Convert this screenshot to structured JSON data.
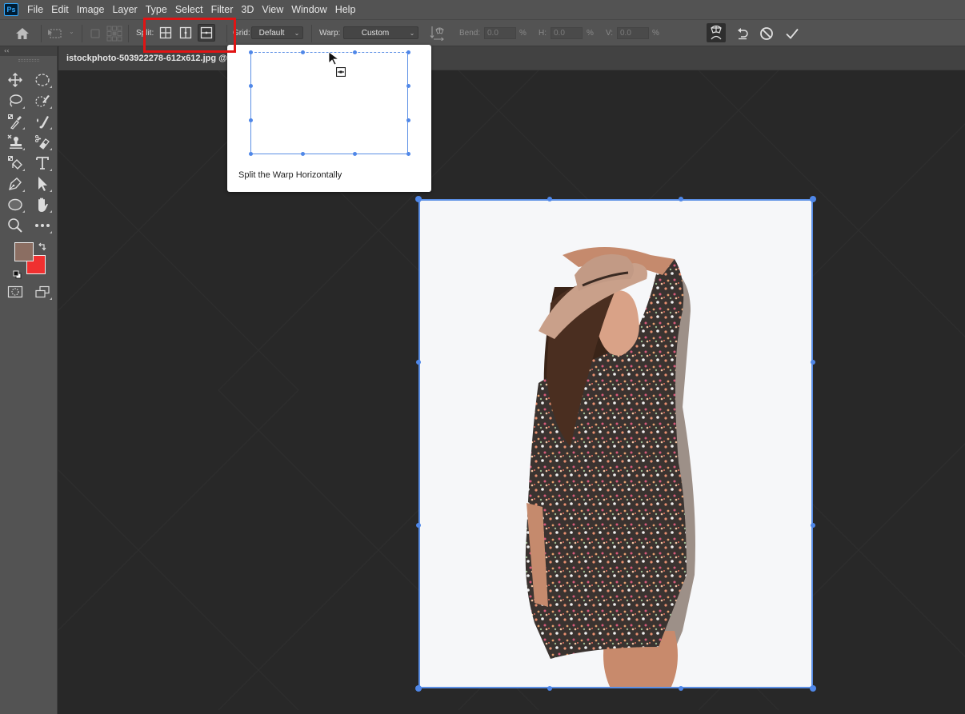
{
  "app": {
    "logo": "Ps",
    "menu": [
      "File",
      "Edit",
      "Image",
      "Layer",
      "Type",
      "Select",
      "Filter",
      "3D",
      "View",
      "Window",
      "Help"
    ]
  },
  "options_bar": {
    "split_label": "Split:",
    "split_buttons": [
      {
        "name": "split-crosswise",
        "icon": "grid-cross-icon"
      },
      {
        "name": "split-vertically",
        "icon": "split-vertical-icon"
      },
      {
        "name": "split-horizontally",
        "icon": "split-horizontal-icon",
        "active": true
      }
    ],
    "grid_label": "Grid:",
    "grid_value": "Default",
    "warp_label": "Warp:",
    "warp_value": "Custom",
    "bend_label": "Bend:",
    "bend_value": "0.0",
    "h_label": "H:",
    "h_value": "0.0",
    "v_label": "V:",
    "v_value": "0.0",
    "percent": "%",
    "right_icons": [
      "warp-mode-icon",
      "undo-icon",
      "cancel-icon",
      "commit-checkmark-icon"
    ]
  },
  "toolbar": {
    "collapse": "‹‹",
    "tools": [
      "move",
      "elliptical-marquee",
      "lasso",
      "quick-selection",
      "eyedropper",
      "brush",
      "clone-stamp",
      "eraser",
      "paint-bucket",
      "type",
      "pen",
      "path-selection",
      "ellipse",
      "hand",
      "zoom",
      "more-tools"
    ],
    "foreground_color": "#8b6e62",
    "background_color": "#f03030"
  },
  "document": {
    "tab_title": "istockphoto-503922278-612x612.jpg @"
  },
  "tooltip": {
    "caption": "Split the Warp Horizontally"
  },
  "colors": {
    "highlight_box": "#e01414",
    "warp_handles": "#4f87e8"
  }
}
